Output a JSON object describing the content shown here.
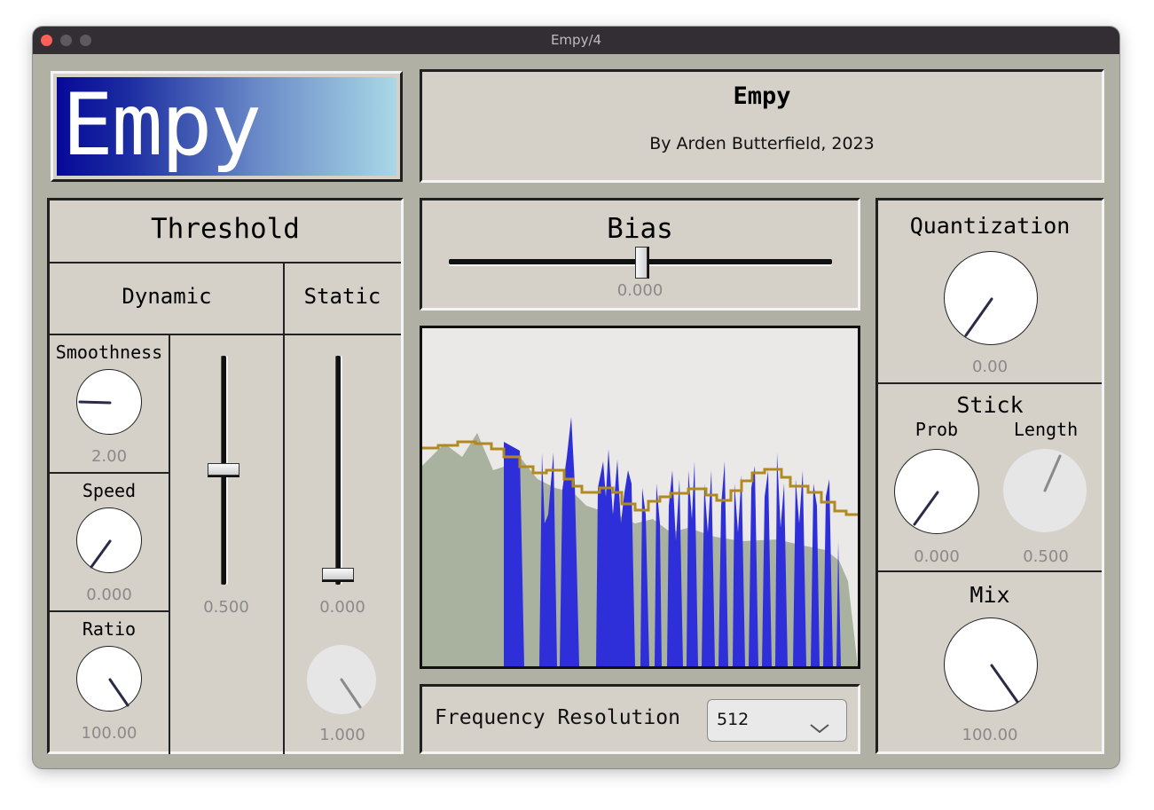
{
  "window": {
    "title": "Empy/4"
  },
  "logo": {
    "text": "Empy"
  },
  "header": {
    "title": "Empy",
    "subtitle": "By Arden Butterfield, 2023"
  },
  "threshold": {
    "title": "Threshold",
    "dynamic": {
      "title": "Dynamic",
      "slider_value": "0.500",
      "slider_level": 0.5
    },
    "static": {
      "title": "Static",
      "slider_value": "0.000",
      "slider_level": 0.0,
      "knob_value": "1.000"
    },
    "smoothness": {
      "label": "Smoothness",
      "value": "2.00"
    },
    "speed": {
      "label": "Speed",
      "value": "0.000"
    },
    "ratio": {
      "label": "Ratio",
      "value": "100.00"
    }
  },
  "bias": {
    "title": "Bias",
    "value": "0.000",
    "level": 0.5
  },
  "frequency_resolution": {
    "label": "Frequency Resolution",
    "selected": "512"
  },
  "quantization": {
    "title": "Quantization",
    "value": "0.00"
  },
  "stick": {
    "title": "Stick",
    "prob": {
      "label": "Prob",
      "value": "0.000"
    },
    "length": {
      "label": "Length",
      "value": "0.500"
    }
  },
  "mix": {
    "title": "Mix",
    "value": "100.00"
  },
  "colors": {
    "panel": "#d5d0c8",
    "background": "#b0b0a4",
    "spectrum_fill": "#2f2fd9",
    "spectrum_bg": "#a9b29f",
    "threshold_line": "#b08a20",
    "knob_pointer": "#2b2b48"
  }
}
